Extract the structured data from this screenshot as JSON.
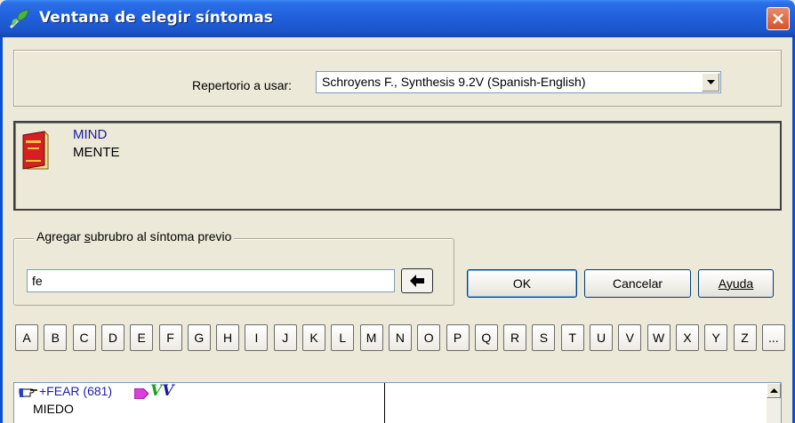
{
  "window": {
    "title": "Ventana de elegir síntomas",
    "icon": "leaf-arrow-icon",
    "close_icon": "close-icon"
  },
  "repertory": {
    "label": "Repertorio a usar:",
    "selected": "Schroyens F., Synthesis 9.2V (Spanish-English)"
  },
  "rubric": {
    "icon": "book-icon",
    "english": "MIND",
    "spanish": "MENTE"
  },
  "subrubric": {
    "legend_prefix": "Agregar ",
    "legend_mnemonic": "s",
    "legend_suffix": "ubrubro al síntoma previo",
    "input_value": "fe"
  },
  "buttons": {
    "ok": "OK",
    "cancel": "Cancelar",
    "help": "Ayuda"
  },
  "letters": [
    "A",
    "B",
    "C",
    "D",
    "E",
    "F",
    "G",
    "H",
    "I",
    "J",
    "K",
    "L",
    "M",
    "N",
    "O",
    "P",
    "Q",
    "R",
    "S",
    "T",
    "U",
    "V",
    "W",
    "X",
    "Y",
    "Z",
    "..."
  ],
  "results": [
    {
      "english": "+FEAR (681)",
      "spanish": "MIEDO",
      "marks": [
        "pointing-hand-icon",
        "tag-icon",
        "V",
        "V"
      ]
    }
  ],
  "colors": {
    "titlebar": "#1f5fd9",
    "rubric_english": "#1a1aa8",
    "v_green": "#1aa31a",
    "v_blue": "#1a1aa8"
  }
}
